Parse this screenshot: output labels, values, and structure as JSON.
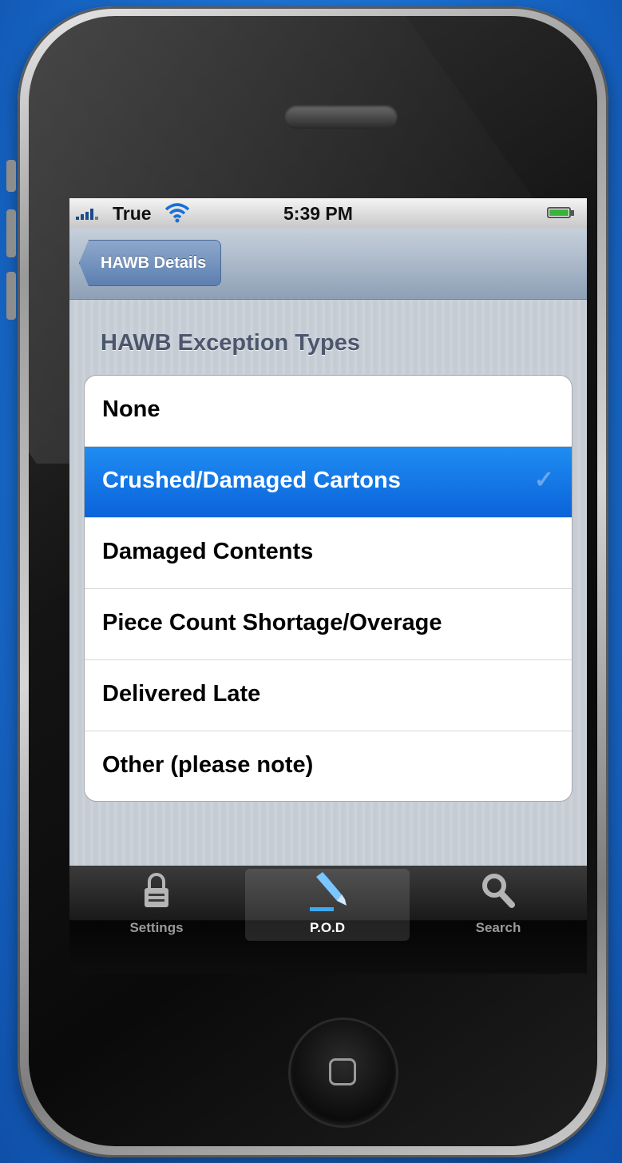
{
  "status_bar": {
    "carrier": "True",
    "time": "5:39 PM"
  },
  "nav_bar": {
    "back_label": "HAWB Details"
  },
  "section": {
    "header": "HAWB Exception Types"
  },
  "exception_types": [
    {
      "label": "None",
      "selected": false
    },
    {
      "label": "Crushed/Damaged Cartons",
      "selected": true
    },
    {
      "label": "Damaged Contents",
      "selected": false
    },
    {
      "label": "Piece Count Shortage/Overage",
      "selected": false
    },
    {
      "label": "Delivered Late",
      "selected": false
    },
    {
      "label": "Other (please note)",
      "selected": false
    }
  ],
  "check_glyph": "✓",
  "tabs": [
    {
      "label": "Settings",
      "icon": "lock-icon",
      "active": false
    },
    {
      "label": "P.O.D",
      "icon": "pen-icon",
      "active": true
    },
    {
      "label": "Search",
      "icon": "search-icon",
      "active": false
    }
  ],
  "colors": {
    "selected_row": "#1473e6",
    "nav_bar": "#a9b7c8",
    "tab_bar": "#1a1a1a"
  }
}
